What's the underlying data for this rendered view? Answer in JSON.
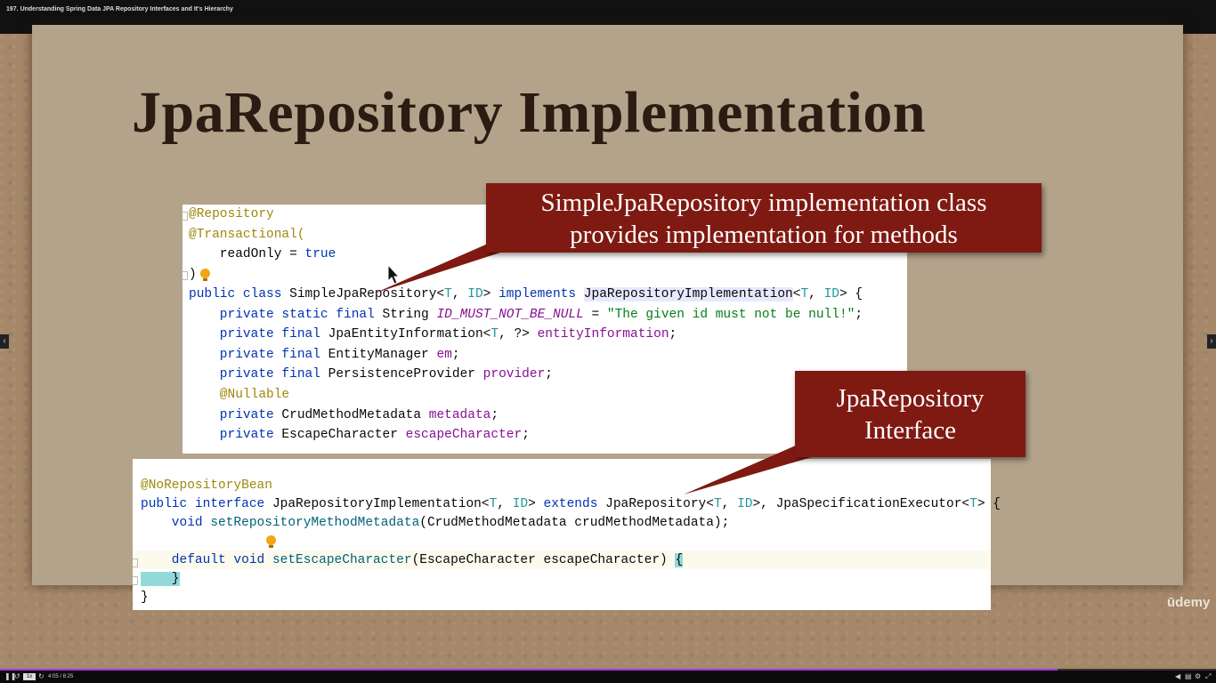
{
  "video": {
    "title": "197. Understanding Spring Data JPA Repository Interfaces and It's Hierarchy"
  },
  "slide": {
    "title": "JpaRepository Implementation",
    "callout1_line1": "SimpleJpaRepository implementation class",
    "callout1_line2": "provides implementation for methods",
    "callout2_line1": "JpaRepository",
    "callout2_line2": "Interface",
    "watermark": "ūdemy"
  },
  "code1": {
    "l1": "@Repository",
    "l2": "@Transactional(",
    "l3a": "    readOnly = ",
    "l3b": "true",
    "l4": ")",
    "l5": {
      "a": "public class ",
      "b": "SimpleJpaRepository<",
      "c": "T",
      "d": ", ",
      "e": "ID",
      "f": "> ",
      "g": "implements ",
      "h": "JpaRepositoryImplementation",
      "i": "<",
      "j": "T",
      "k": ", ",
      "l": "ID",
      "m": "> {"
    },
    "l6": {
      "a": "    private static final ",
      "b": "String ",
      "c": "ID_MUST_NOT_BE_NULL",
      "d": " = ",
      "e": "\"The given id must not be null!\"",
      "f": ";"
    },
    "l7": {
      "a": "    private final ",
      "b": "JpaEntityInformation<",
      "c": "T",
      "d": ", ?> ",
      "e": "entityInformation",
      "f": ";"
    },
    "l8": {
      "a": "    private final ",
      "b": "EntityManager ",
      "c": "em",
      "d": ";"
    },
    "l9": {
      "a": "    private final ",
      "b": "PersistenceProvider ",
      "c": "provider",
      "d": ";"
    },
    "l10": "    @Nullable",
    "l11": {
      "a": "    private ",
      "b": "CrudMethodMetadata ",
      "c": "metadata",
      "d": ";"
    },
    "l12": {
      "a": "    private ",
      "b": "EscapeCharacter ",
      "c": "escapeCharacter",
      "d": ";"
    }
  },
  "code2": {
    "l1": "@NoRepositoryBean",
    "l2": {
      "a": "public interface ",
      "b": "JpaRepositoryImplementation<",
      "c": "T",
      "d": ", ",
      "e": "ID",
      "f": "> ",
      "g": "extends ",
      "h": "JpaRepository<",
      "i": "T",
      "j": ", ",
      "k": "ID",
      "l": ">, JpaSpecificationExecutor<",
      "m": "T",
      "n": "> {"
    },
    "l3": {
      "a": "    void ",
      "b": "setRepositoryMethodMetadata",
      "c": "(CrudMethodMetadata crudMethodMetadata);"
    },
    "l4": {
      "a": "    default void ",
      "b": "setEscapeCharacter",
      "c": "(EscapeCharacter escapeCharacter) ",
      "d": "{"
    },
    "l5": "    }",
    "l6": "}"
  },
  "player": {
    "speed": "1x",
    "time": "4:05 / 8:25",
    "progress": 0.87,
    "colors": {
      "progress": "#a435f0",
      "callout": "#7f1a12"
    }
  }
}
